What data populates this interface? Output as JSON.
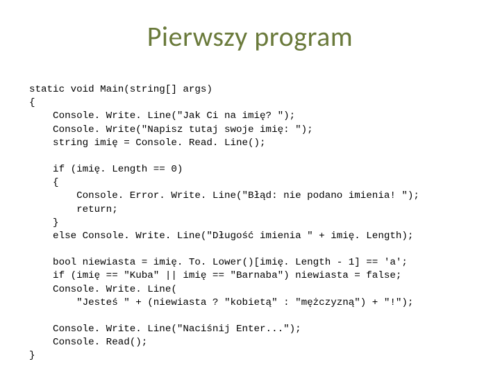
{
  "title": "Pierwszy program",
  "code": {
    "l01": "static void Main(string[] args)",
    "l02": "{",
    "l03": "    Console. Write. Line(\"Jak Ci na imię? \");",
    "l04": "    Console. Write(\"Napisz tutaj swoje imię: \");",
    "l05": "    string imię = Console. Read. Line();",
    "l06": "",
    "l07": "    if (imię. Length == 0)",
    "l08": "    {",
    "l09": "        Console. Error. Write. Line(\"Błąd: nie podano imienia! \");",
    "l10": "        return;",
    "l11": "    }",
    "l12": "    else Console. Write. Line(\"Długość imienia \" + imię. Length);",
    "l13": "",
    "l14": "    bool niewiasta = imię. To. Lower()[imię. Length - 1] == 'a';",
    "l15": "    if (imię == \"Kuba\" || imię == \"Barnaba\") niewiasta = false;",
    "l16": "    Console. Write. Line(",
    "l17": "        \"Jesteś \" + (niewiasta ? \"kobietą\" : \"mężczyzną\") + \"!\");",
    "l18": "",
    "l19": "    Console. Write. Line(\"Naciśnij Enter...\");",
    "l20": "    Console. Read();",
    "l21": "}"
  }
}
